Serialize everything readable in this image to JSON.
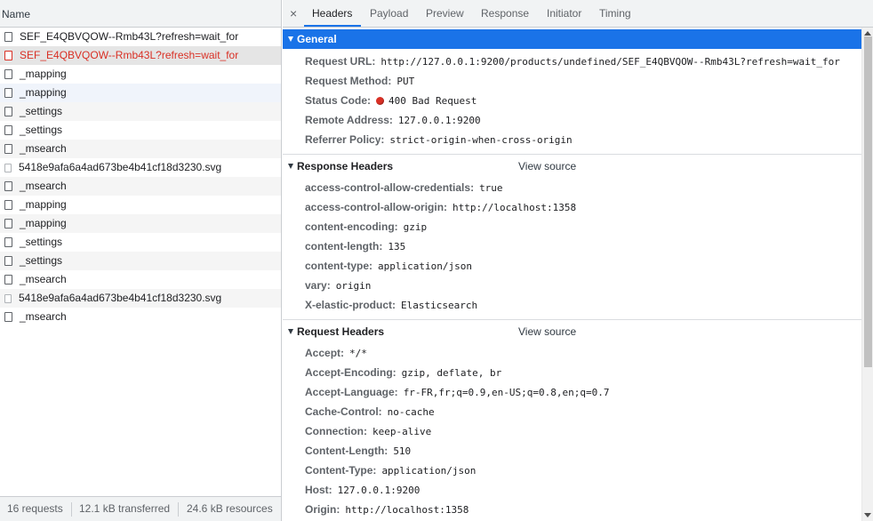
{
  "request_list": {
    "header": "Name",
    "rows": [
      {
        "name": "SEF_E4QBVQOW--Rmb43L?refresh=wait_for",
        "icon": "document-icon"
      },
      {
        "name": "SEF_E4QBVQOW--Rmb43L?refresh=wait_for",
        "icon": "document-icon"
      },
      {
        "name": "_mapping",
        "icon": "document-icon"
      },
      {
        "name": "_mapping",
        "icon": "document-icon"
      },
      {
        "name": "_settings",
        "icon": "document-icon"
      },
      {
        "name": "_settings",
        "icon": "document-icon"
      },
      {
        "name": "_msearch",
        "icon": "document-icon"
      },
      {
        "name": "5418e9afa6a4ad673be4b41cf18d3230.svg",
        "icon": "image-icon"
      },
      {
        "name": "_msearch",
        "icon": "document-icon"
      },
      {
        "name": "_mapping",
        "icon": "document-icon"
      },
      {
        "name": "_mapping",
        "icon": "document-icon"
      },
      {
        "name": "_settings",
        "icon": "document-icon"
      },
      {
        "name": "_settings",
        "icon": "document-icon"
      },
      {
        "name": "_msearch",
        "icon": "document-icon"
      },
      {
        "name": "5418e9afa6a4ad673be4b41cf18d3230.svg",
        "icon": "image-icon"
      },
      {
        "name": "_msearch",
        "icon": "document-icon"
      }
    ]
  },
  "statusbar": {
    "requests": "16 requests",
    "transferred": "12.1 kB transferred",
    "resources": "24.6 kB resources"
  },
  "tabs": {
    "close": "×",
    "items": [
      "Headers",
      "Payload",
      "Preview",
      "Response",
      "Initiator",
      "Timing"
    ],
    "active": "Headers"
  },
  "general": {
    "title": "General",
    "rows": [
      {
        "name": "Request URL:",
        "value": "http://127.0.0.1:9200/products/undefined/SEF_E4QBVQOW--Rmb43L?refresh=wait_for"
      },
      {
        "name": "Request Method:",
        "value": "PUT"
      },
      {
        "name": "Status Code:",
        "value": "400 Bad Request"
      },
      {
        "name": "Remote Address:",
        "value": "127.0.0.1:9200"
      },
      {
        "name": "Referrer Policy:",
        "value": "strict-origin-when-cross-origin"
      }
    ]
  },
  "response_headers": {
    "title": "Response Headers",
    "view_source": "View source",
    "rows": [
      {
        "name": "access-control-allow-credentials:",
        "value": "true"
      },
      {
        "name": "access-control-allow-origin:",
        "value": "http://localhost:1358"
      },
      {
        "name": "content-encoding:",
        "value": "gzip"
      },
      {
        "name": "content-length:",
        "value": "135"
      },
      {
        "name": "content-type:",
        "value": "application/json"
      },
      {
        "name": "vary:",
        "value": "origin"
      },
      {
        "name": "X-elastic-product:",
        "value": "Elasticsearch"
      }
    ]
  },
  "request_headers": {
    "title": "Request Headers",
    "view_source": "View source",
    "rows": [
      {
        "name": "Accept:",
        "value": "*/*"
      },
      {
        "name": "Accept-Encoding:",
        "value": "gzip, deflate, br"
      },
      {
        "name": "Accept-Language:",
        "value": "fr-FR,fr;q=0.9,en-US;q=0.8,en;q=0.7"
      },
      {
        "name": "Cache-Control:",
        "value": "no-cache"
      },
      {
        "name": "Connection:",
        "value": "keep-alive"
      },
      {
        "name": "Content-Length:",
        "value": "510"
      },
      {
        "name": "Content-Type:",
        "value": "application/json"
      },
      {
        "name": "Host:",
        "value": "127.0.0.1:9200"
      },
      {
        "name": "Origin:",
        "value": "http://localhost:1358"
      }
    ]
  },
  "colors": {
    "accent": "#1a73e8",
    "error": "#d93025"
  }
}
